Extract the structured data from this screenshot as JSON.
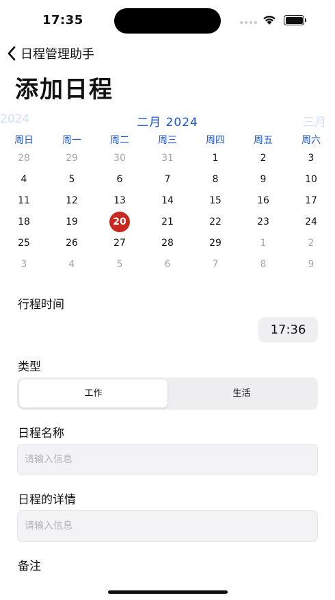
{
  "status_bar": {
    "time": "17:35"
  },
  "nav": {
    "back_label": "日程管理助手",
    "page_title": "添加日程"
  },
  "calendar": {
    "prev_label": "2024",
    "month_label": "二月 2024",
    "next_label": "三月",
    "weekdays": [
      "周日",
      "周一",
      "周二",
      "周三",
      "周四",
      "周五",
      "周六"
    ],
    "selected_day": "20",
    "selected_color": "#c8281f",
    "weeks": [
      [
        {
          "d": "28",
          "m": "other"
        },
        {
          "d": "29",
          "m": "other"
        },
        {
          "d": "30",
          "m": "other"
        },
        {
          "d": "31",
          "m": "other"
        },
        {
          "d": "1",
          "m": "cur"
        },
        {
          "d": "2",
          "m": "cur"
        },
        {
          "d": "3",
          "m": "cur"
        }
      ],
      [
        {
          "d": "4",
          "m": "cur"
        },
        {
          "d": "5",
          "m": "cur"
        },
        {
          "d": "6",
          "m": "cur"
        },
        {
          "d": "7",
          "m": "cur"
        },
        {
          "d": "8",
          "m": "cur"
        },
        {
          "d": "9",
          "m": "cur"
        },
        {
          "d": "10",
          "m": "cur"
        }
      ],
      [
        {
          "d": "11",
          "m": "cur"
        },
        {
          "d": "12",
          "m": "cur"
        },
        {
          "d": "13",
          "m": "cur"
        },
        {
          "d": "14",
          "m": "cur"
        },
        {
          "d": "15",
          "m": "cur"
        },
        {
          "d": "16",
          "m": "cur"
        },
        {
          "d": "17",
          "m": "cur"
        }
      ],
      [
        {
          "d": "18",
          "m": "cur"
        },
        {
          "d": "19",
          "m": "cur"
        },
        {
          "d": "20",
          "m": "sel"
        },
        {
          "d": "21",
          "m": "cur"
        },
        {
          "d": "22",
          "m": "cur"
        },
        {
          "d": "23",
          "m": "cur"
        },
        {
          "d": "24",
          "m": "cur"
        }
      ],
      [
        {
          "d": "25",
          "m": "cur"
        },
        {
          "d": "26",
          "m": "cur"
        },
        {
          "d": "27",
          "m": "cur"
        },
        {
          "d": "28",
          "m": "cur"
        },
        {
          "d": "29",
          "m": "cur"
        },
        {
          "d": "1",
          "m": "other"
        },
        {
          "d": "2",
          "m": "other"
        }
      ],
      [
        {
          "d": "3",
          "m": "other"
        },
        {
          "d": "4",
          "m": "other"
        },
        {
          "d": "5",
          "m": "other"
        },
        {
          "d": "6",
          "m": "other"
        },
        {
          "d": "7",
          "m": "other"
        },
        {
          "d": "8",
          "m": "other"
        },
        {
          "d": "9",
          "m": "other"
        }
      ]
    ]
  },
  "form": {
    "time_label": "行程时间",
    "time_value": "17:36",
    "type_label": "类型",
    "type_options": [
      "工作",
      "生活"
    ],
    "type_selected": "工作",
    "name_label": "日程名称",
    "name_placeholder": "请输入信息",
    "name_value": "",
    "detail_label": "日程的详情",
    "detail_placeholder": "请输入信息",
    "detail_value": "",
    "notes_label": "备注"
  },
  "colors": {
    "accent_blue": "#1b57c9",
    "selected_red": "#c8281f"
  },
  "icons": {
    "back": "chevron-left-icon",
    "wifi": "wifi-icon",
    "battery": "battery-icon",
    "signal": "signal-dots-icon"
  }
}
